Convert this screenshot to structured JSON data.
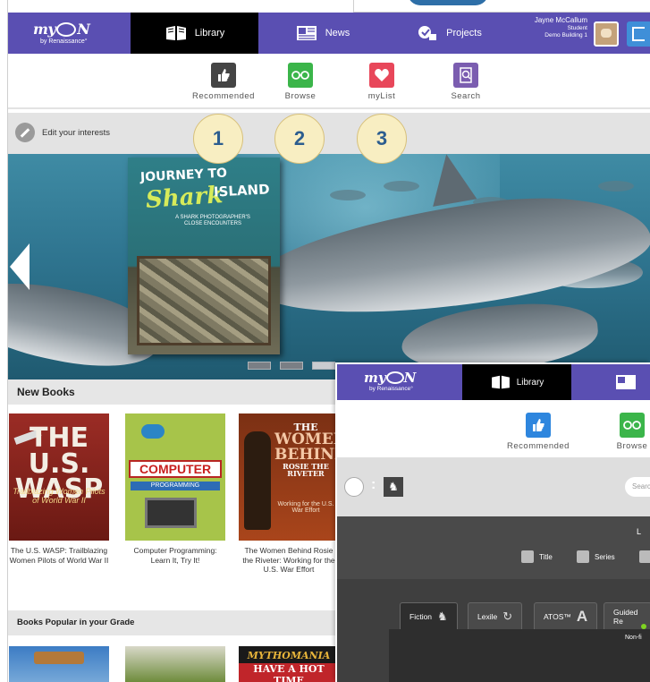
{
  "main": {
    "nav": {
      "logo": "myON",
      "logo_sub": "by Renaissance°",
      "tabs": [
        {
          "label": "Library",
          "icon": "book-icon"
        },
        {
          "label": "News",
          "icon": "newspaper-icon"
        },
        {
          "label": "Projects",
          "icon": "projects-icon"
        }
      ],
      "user": {
        "name": "Jayne McCallum",
        "role": "Student",
        "school": "Demo Building 1"
      }
    },
    "subnav": [
      {
        "label": "Recommended",
        "icon": "thumbs-up-icon",
        "color": "#444444"
      },
      {
        "label": "Browse",
        "icon": "glasses-icon",
        "color": "#3bb54a"
      },
      {
        "label": "myList",
        "icon": "heart-icon",
        "color": "#e8475a"
      },
      {
        "label": "Search",
        "icon": "search-icon",
        "color": "#7b5db0"
      }
    ],
    "interests_label": "Edit your interests",
    "callouts": [
      "1",
      "2",
      "3"
    ],
    "hero": {
      "book_title_line1": "JOURNEY TO",
      "book_title_line2": "Shark",
      "book_title_line3": "ISLAND",
      "book_subtitle": "A SHARK PHOTOGRAPHER'S CLOSE ENCOUNTERS"
    },
    "new_books": {
      "heading": "New Books",
      "items": [
        {
          "title": "The U.S. WASP: Trailblazing Women Pilots of World War II",
          "cover_big": "THE U.S. WASP",
          "cover_small": "Trailblazing Women Pilots of World War II"
        },
        {
          "title": "Computer Programming: Learn It, Try It!",
          "cover_big": "COMPUTER",
          "cover_small": "PROGRAMMING"
        },
        {
          "title": "The Women Behind Rosie the Riveter: Working for the U.S. War Effort",
          "cover_a": "THE",
          "cover_b": "WOMEN BEHIND",
          "cover_c": "ROSIE THE RIVETER",
          "cover_small": "Working for the U.S. War Effort"
        }
      ]
    },
    "popular": {
      "heading": "Books Popular in your Grade",
      "third_cover_top": "MYTHOMANIA",
      "third_cover_bottom": "HAVE A HOT TIME"
    }
  },
  "overlay": {
    "logo": "myON",
    "logo_sub": "by Renaissance°",
    "tab": "Library",
    "subnav": [
      {
        "label": "Recommended",
        "icon": "thumbs-up-icon",
        "color": "#2e86de"
      },
      {
        "label": "Browse",
        "icon": "glasses-icon",
        "color": "#3bb54a"
      }
    ],
    "search_placeholder": "Search",
    "filters_label": "L",
    "checkboxes": [
      "Title",
      "Series"
    ],
    "filter_tabs": [
      {
        "label": "Fiction",
        "glyph": "🐎"
      },
      {
        "label": "Lexile",
        "glyph": "↻"
      },
      {
        "label": "ATOS™",
        "glyph": "A"
      },
      {
        "label": "Guided Re",
        "glyph": ""
      }
    ],
    "nonfiction_label": "Non-fi"
  }
}
